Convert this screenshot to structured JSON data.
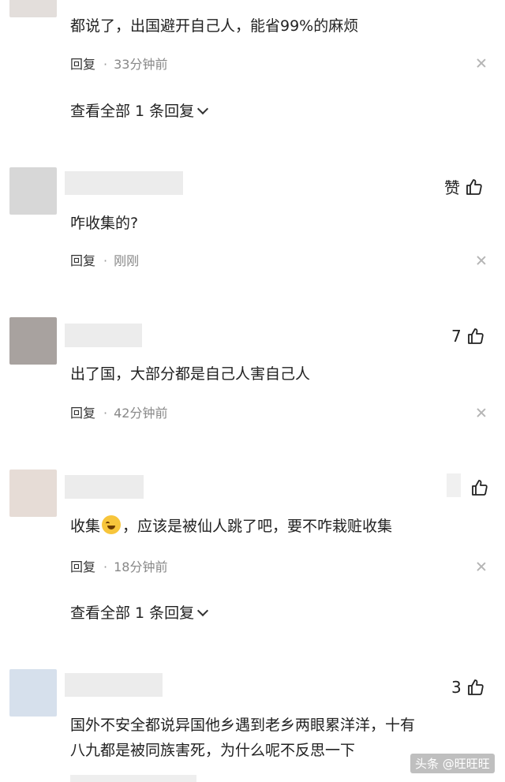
{
  "comments": [
    {
      "text": "都说了，出国避开自己人，能省99%的麻烦",
      "reply_label": "回复",
      "time": "33分钟前",
      "view_replies": "查看全部 1 条回复"
    },
    {
      "like_label": "赞",
      "text": "咋收集的?",
      "reply_label": "回复",
      "time": "刚刚"
    },
    {
      "like_count": "7",
      "text": "出了国，大部分都是自己人害自己人",
      "reply_label": "回复",
      "time": "42分钟前"
    },
    {
      "text_before_emoji": "收集",
      "text_after_emoji": "，应该是被仙人跳了吧，要不咋栽赃收集",
      "reply_label": "回复",
      "time": "18分钟前",
      "view_replies": "查看全部 1 条回复"
    },
    {
      "like_count": "3",
      "text_line1": "国外不安全都说异国他乡遇到老乡两眼累洋洋，十有",
      "text_line2": "八九都是被同族害死，为什么呢不反思一下"
    }
  ],
  "watermark": "头条 @旺旺旺",
  "colors": {
    "avatar1": "#d7d7d7",
    "avatar2": "#a8a29f",
    "avatar3": "#e6dcd6",
    "avatar4": "#d6e0ec"
  }
}
